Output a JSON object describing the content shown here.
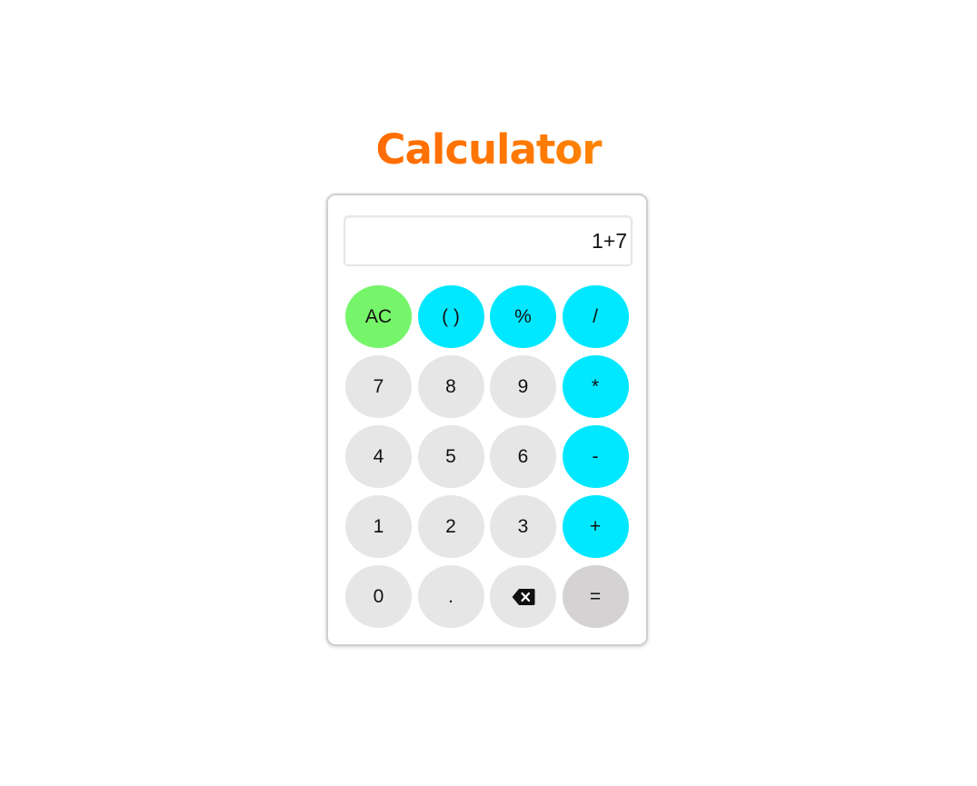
{
  "title": "Calculator",
  "display": {
    "value": "1+7"
  },
  "keys": [
    {
      "label": "AC",
      "kind": "clear",
      "name": "ac-button"
    },
    {
      "label": "( )",
      "kind": "op",
      "name": "parentheses-button"
    },
    {
      "label": "%",
      "kind": "op",
      "name": "percent-button"
    },
    {
      "label": "/",
      "kind": "op",
      "name": "divide-button"
    },
    {
      "label": "7",
      "kind": "digit",
      "name": "digit-7-button"
    },
    {
      "label": "8",
      "kind": "digit",
      "name": "digit-8-button"
    },
    {
      "label": "9",
      "kind": "digit",
      "name": "digit-9-button"
    },
    {
      "label": "*",
      "kind": "op",
      "name": "multiply-button"
    },
    {
      "label": "4",
      "kind": "digit",
      "name": "digit-4-button"
    },
    {
      "label": "5",
      "kind": "digit",
      "name": "digit-5-button"
    },
    {
      "label": "6",
      "kind": "digit",
      "name": "digit-6-button"
    },
    {
      "label": "-",
      "kind": "op",
      "name": "subtract-button"
    },
    {
      "label": "1",
      "kind": "digit",
      "name": "digit-1-button"
    },
    {
      "label": "2",
      "kind": "digit",
      "name": "digit-2-button"
    },
    {
      "label": "3",
      "kind": "digit",
      "name": "digit-3-button"
    },
    {
      "label": "+",
      "kind": "op",
      "name": "add-button"
    },
    {
      "label": "0",
      "kind": "digit",
      "name": "digit-0-button"
    },
    {
      "label": ".",
      "kind": "digit",
      "name": "decimal-button"
    },
    {
      "label": "",
      "kind": "digit",
      "icon": "backspace-icon",
      "name": "backspace-button"
    },
    {
      "label": "=",
      "kind": "equals",
      "name": "equals-button"
    }
  ],
  "colors": {
    "digit": "#e6e6e6",
    "operator": "#00e8ff",
    "clear": "#76f56a",
    "equals": "#d4d2d3",
    "title_gradient": [
      "#ff4a0a",
      "#ff7a00",
      "#f4c20d"
    ]
  }
}
